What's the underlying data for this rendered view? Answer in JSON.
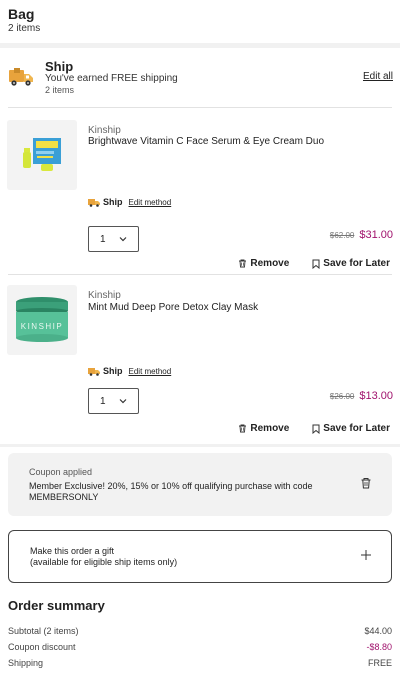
{
  "header": {
    "title": "Bag",
    "count": "2 items"
  },
  "ship_group": {
    "title": "Ship",
    "subtitle": "You've earned FREE shipping",
    "items": "2 items",
    "edit_all": "Edit all"
  },
  "items": [
    {
      "brand": "Kinship",
      "name": "Brightwave Vitamin C Face Serum & Eye Cream Duo",
      "ship_label": "Ship",
      "edit_method": "Edit method",
      "qty": "1",
      "price_old": "$62.00",
      "price_new": "$31.00",
      "remove": "Remove",
      "save_later": "Save for Later"
    },
    {
      "brand": "Kinship",
      "name": "Mint Mud Deep Pore Detox Clay Mask",
      "ship_label": "Ship",
      "edit_method": "Edit method",
      "qty": "1",
      "price_old": "$26.00",
      "price_new": "$13.00",
      "remove": "Remove",
      "save_later": "Save for Later"
    }
  ],
  "coupon": {
    "label": "Coupon applied",
    "text": "Member Exclusive! 20%, 15% or 10% off qualifying purchase with code MEMBERSONLY"
  },
  "gift": {
    "title": "Make this order a gift",
    "subtitle": "(available for eligible ship items only)"
  },
  "summary": {
    "title": "Order summary",
    "rows": [
      {
        "label": "Subtotal (2 items)",
        "value": "$44.00"
      },
      {
        "label": "Coupon discount",
        "value": "-$8.80"
      },
      {
        "label": "Shipping",
        "value": "FREE"
      }
    ]
  },
  "colors": {
    "sale_price": "#a0126c",
    "truck_body": "#e8a33c"
  },
  "product_logo_text": "KINSHIP"
}
